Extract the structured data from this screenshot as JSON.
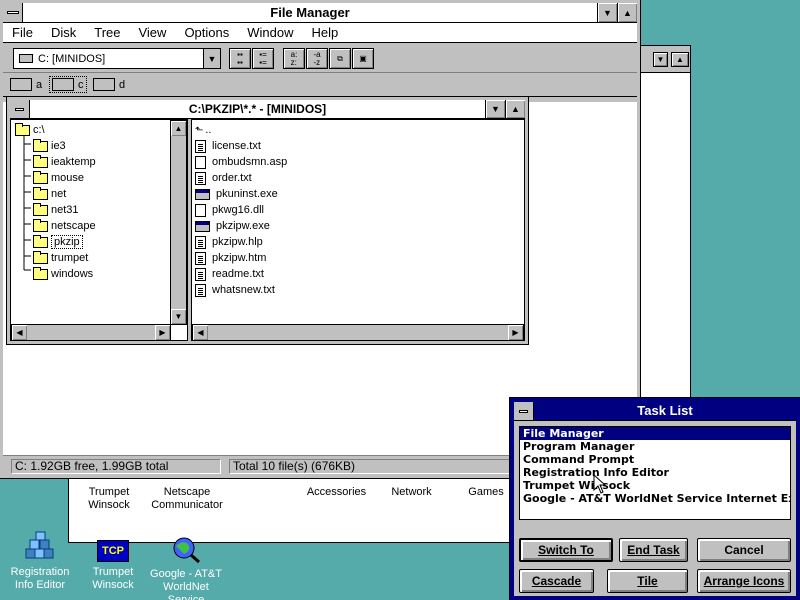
{
  "file_manager": {
    "title": "File Manager",
    "menu": [
      "File",
      "Disk",
      "Tree",
      "View",
      "Options",
      "Window",
      "Help"
    ],
    "drive_select": "C: [MINIDOS]",
    "drives": [
      "a",
      "c",
      "d"
    ],
    "status_free": "C: 1.92GB free,  1.99GB total",
    "status_total": "Total 10 file(s) (676KB)"
  },
  "dir_window": {
    "title": "C:\\PKZIP\\*.* - [MINIDOS]",
    "tree": [
      "c:\\",
      "ie3",
      "ieaktemp",
      "mouse",
      "net",
      "net31",
      "netscape",
      "pkzip",
      "trumpet",
      "windows"
    ],
    "files": [
      {
        "name": "..",
        "kind": "up"
      },
      {
        "name": "license.txt",
        "kind": "txt"
      },
      {
        "name": "ombudsmn.asp",
        "kind": "doc"
      },
      {
        "name": "order.txt",
        "kind": "txt"
      },
      {
        "name": "pkuninst.exe",
        "kind": "exe"
      },
      {
        "name": "pkwg16.dll",
        "kind": "doc"
      },
      {
        "name": "pkzipw.exe",
        "kind": "exe"
      },
      {
        "name": "pkzipw.hlp",
        "kind": "txt"
      },
      {
        "name": "pkzipw.htm",
        "kind": "txt"
      },
      {
        "name": "readme.txt",
        "kind": "txt"
      },
      {
        "name": "whatsnew.txt",
        "kind": "txt"
      }
    ]
  },
  "program_group": {
    "items": [
      "Trumpet\nWinsock",
      "Netscape\nCommunicator",
      "Accessories",
      "Network",
      "Games"
    ]
  },
  "desktop_icons": [
    {
      "label": "Registration\nInfo Editor"
    },
    {
      "label": "Trumpet\nWinsock"
    },
    {
      "label": "Google - AT&T\nWorldNet\nService"
    }
  ],
  "task_list": {
    "title": "Task List",
    "items": [
      "File Manager",
      "Program Manager",
      "Command Prompt",
      "Registration Info Editor",
      "Trumpet Winsock",
      "Google - AT&T WorldNet Service Internet Explorer"
    ],
    "buttons": {
      "switch_to": "Switch To",
      "end_task": "End Task",
      "cancel": "Cancel",
      "cascade": "Cascade",
      "tile": "Tile",
      "arrange_icons": "Arrange Icons"
    }
  },
  "tcp_label": "TCP",
  "colors": {
    "desktop": "#55aaaa",
    "active_title": "#000080",
    "folder": "#ffff80"
  }
}
